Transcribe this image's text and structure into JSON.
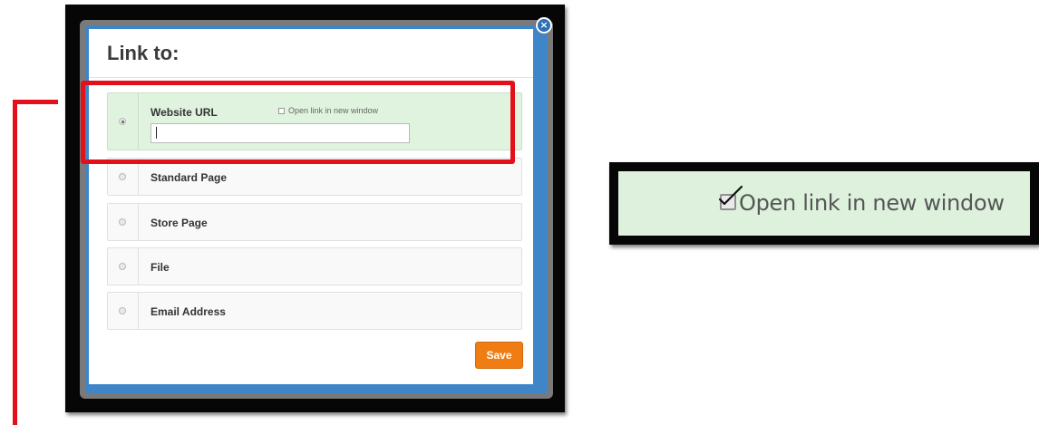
{
  "dialog": {
    "title": "Link to:",
    "close_symbol": "×",
    "options": [
      {
        "label": "Website URL",
        "selected": true
      },
      {
        "label": "Standard Page",
        "selected": false
      },
      {
        "label": "Store Page",
        "selected": false
      },
      {
        "label": "File",
        "selected": false
      },
      {
        "label": "Email Address",
        "selected": false
      }
    ],
    "new_window_label": "Open link in new window",
    "url_value": "",
    "save_label": "Save"
  },
  "callout": {
    "label": "Open link in new window",
    "checked": true
  },
  "colors": {
    "highlight": "#e3101b",
    "selected_row": "#dff3df",
    "save_button": "#f07d14",
    "dialog_border": "#3f86c8"
  },
  "icons": {
    "close": "close-icon",
    "checkmark": "checkmark-icon"
  }
}
